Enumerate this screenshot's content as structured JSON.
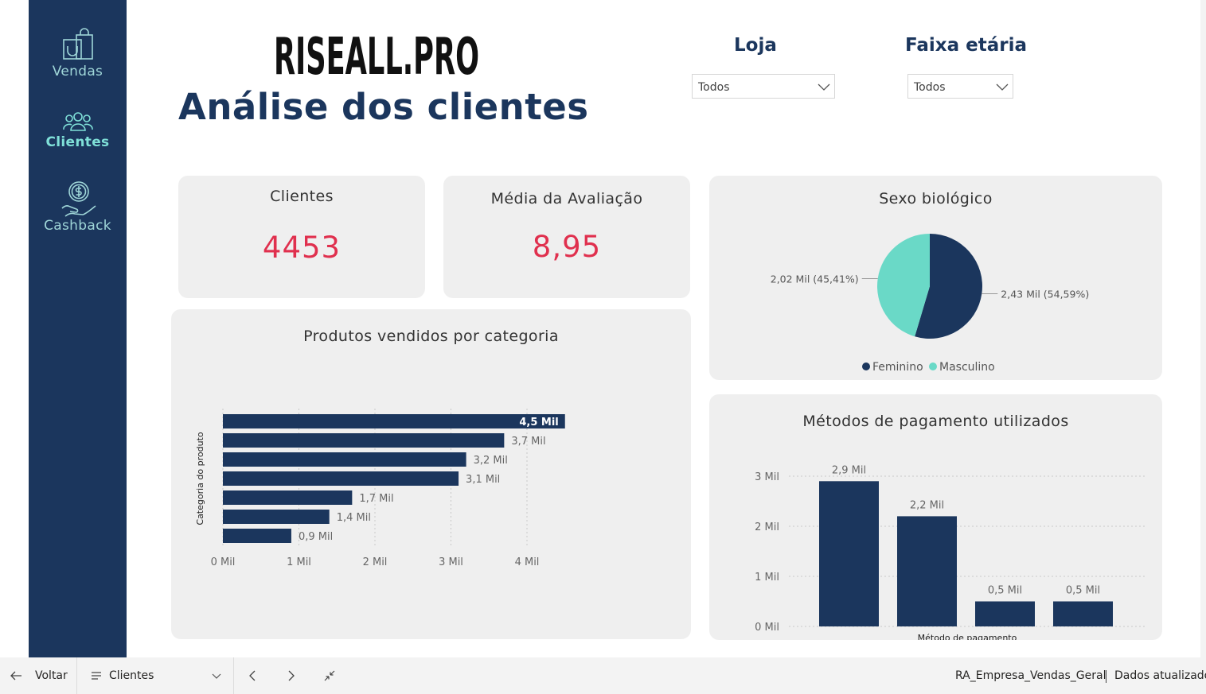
{
  "sidebar": {
    "items": [
      {
        "label": "Vendas",
        "icon": "shopping-bag-icon",
        "active": false
      },
      {
        "label": "Clientes",
        "icon": "users-icon",
        "active": true
      },
      {
        "label": "Cashback",
        "icon": "cashback-hand-icon",
        "active": false
      }
    ]
  },
  "header": {
    "logo_text": "RISEALL.PRO",
    "title": "Análise dos clientes"
  },
  "filters": {
    "loja": {
      "title": "Loja",
      "value": "Todos"
    },
    "faixa": {
      "title": "Faixa etária",
      "value": "Todos"
    }
  },
  "kpis": {
    "clientes": {
      "title": "Clientes",
      "value": "4453"
    },
    "media": {
      "title": "Média da Avaliação",
      "value": "8,95"
    }
  },
  "colors": {
    "navy": "#1b365d",
    "teal": "#6ad9c7",
    "kpi_red": "#e0304e",
    "card_bg": "#efefef"
  },
  "chart_data": [
    {
      "type": "pie",
      "title": "Sexo biológico",
      "series": [
        {
          "name": "Feminino",
          "value": 2.43,
          "percent": 54.59,
          "label": "2,43 Mil (54,59%)",
          "color": "#1b365d"
        },
        {
          "name": "Masculino",
          "value": 2.02,
          "percent": 45.41,
          "label": "2,02 Mil (45,41%)",
          "color": "#6ad9c7"
        }
      ],
      "legend": [
        "Feminino",
        "Masculino"
      ],
      "legend_position": "bottom"
    },
    {
      "type": "bar",
      "orientation": "horizontal",
      "title": "Produtos vendidos por categoria",
      "ylabel": "Categoria do produto",
      "values": [
        4.5,
        3.7,
        3.2,
        3.1,
        1.7,
        1.4,
        0.9
      ],
      "labels": [
        "4,5 Mil",
        "3,7 Mil",
        "3,2 Mil",
        "3,1 Mil",
        "1,7 Mil",
        "1,4 Mil",
        "0,9 Mil"
      ],
      "xticks": [
        "0 Mil",
        "1 Mil",
        "2 Mil",
        "3 Mil",
        "4 Mil"
      ],
      "xlim": [
        0,
        4.7
      ],
      "grid": true
    },
    {
      "type": "bar",
      "orientation": "vertical",
      "title": "Métodos de pagamento utilizados",
      "xlabel": "Método de pagamento",
      "values": [
        2.9,
        2.2,
        0.5,
        0.5
      ],
      "labels": [
        "2,9 Mil",
        "2,2 Mil",
        "0,5 Mil",
        "0,5 Mil"
      ],
      "yticks": [
        "0 Mil",
        "1 Mil",
        "2 Mil",
        "3 Mil"
      ],
      "ylim": [
        0,
        3.2
      ],
      "grid": true
    }
  ],
  "bottombar": {
    "back_label": "Voltar",
    "page_label": "Clientes",
    "dataset": "RA_Empresa_Vendas_Geral",
    "status": "Dados atualizados"
  }
}
